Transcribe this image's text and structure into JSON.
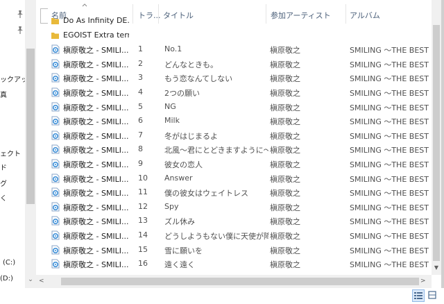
{
  "navigation": {
    "items": [
      {
        "label": "ックアップ"
      },
      {
        "label": "真"
      },
      {
        "label": "ェクト"
      },
      {
        "label": "ド"
      },
      {
        "label": "グ"
      },
      {
        "label": "く"
      },
      {
        "label": "(C:)"
      },
      {
        "label": "(D:)"
      }
    ]
  },
  "columns": {
    "name": "名前",
    "track": "トラ...",
    "title": "タイトル",
    "artist": "参加アーティスト",
    "album": "アルバム"
  },
  "folders": [
    {
      "name": "Do As Infinity DE..."
    },
    {
      "name": "EGOIST Extra terr..."
    }
  ],
  "files": [
    {
      "name": "槇原敬之 - SMILI...",
      "track": "1",
      "title": "No.1",
      "artist": "槇原敬之",
      "album": "SMILING ～THE BEST ..."
    },
    {
      "name": "槇原敬之 - SMILI...",
      "track": "2",
      "title": "どんなときも。",
      "artist": "槇原敬之",
      "album": "SMILING ～THE BEST ..."
    },
    {
      "name": "槇原敬之 - SMILI...",
      "track": "3",
      "title": "もう恋なんてしない",
      "artist": "槇原敬之",
      "album": "SMILING ～THE BEST ..."
    },
    {
      "name": "槇原敬之 - SMILI...",
      "track": "4",
      "title": "2つの願い",
      "artist": "槇原敬之",
      "album": "SMILING ～THE BEST ..."
    },
    {
      "name": "槇原敬之 - SMILI...",
      "track": "5",
      "title": "NG",
      "artist": "槇原敬之",
      "album": "SMILING ～THE BEST ..."
    },
    {
      "name": "槇原敬之 - SMILI...",
      "track": "6",
      "title": "Milk",
      "artist": "槇原敬之",
      "album": "SMILING ～THE BEST ..."
    },
    {
      "name": "槇原敬之 - SMILI...",
      "track": "7",
      "title": "冬がはじまるよ",
      "artist": "槇原敬之",
      "album": "SMILING ～THE BEST ..."
    },
    {
      "name": "槇原敬之 - SMILI...",
      "track": "8",
      "title": "北風～君にとどきますように～",
      "artist": "槇原敬之",
      "album": "SMILING ～THE BEST ..."
    },
    {
      "name": "槇原敬之 - SMILI...",
      "track": "9",
      "title": "彼女の恋人",
      "artist": "槇原敬之",
      "album": "SMILING ～THE BEST ..."
    },
    {
      "name": "槇原敬之 - SMILI...",
      "track": "10",
      "title": "Answer",
      "artist": "槇原敬之",
      "album": "SMILING ～THE BEST ..."
    },
    {
      "name": "槇原敬之 - SMILI...",
      "track": "11",
      "title": "僕の彼女はウェイトレス",
      "artist": "槇原敬之",
      "album": "SMILING ～THE BEST ..."
    },
    {
      "name": "槇原敬之 - SMILI...",
      "track": "12",
      "title": "Spy",
      "artist": "槇原敬之",
      "album": "SMILING ～THE BEST ..."
    },
    {
      "name": "槇原敬之 - SMILI...",
      "track": "13",
      "title": "ズル休み",
      "artist": "槇原敬之",
      "album": "SMILING ～THE BEST ..."
    },
    {
      "name": "槇原敬之 - SMILI...",
      "track": "14",
      "title": "どうしようもない僕に天使が降...",
      "artist": "槇原敬之",
      "album": "SMILING ～THE BEST ..."
    },
    {
      "name": "槇原敬之 - SMILI...",
      "track": "15",
      "title": "雪に願いを",
      "artist": "槇原敬之",
      "album": "SMILING ～THE BEST ..."
    },
    {
      "name": "槇原敬之 - SMILI...",
      "track": "16",
      "title": "遠く遠く",
      "artist": "槇原敬之",
      "album": "SMILING ～THE BEST ..."
    }
  ],
  "icons": {
    "folder": "folder-icon",
    "audio_file": "audio-file-icon",
    "pin": "pin-icon",
    "view_details": "details-view-icon",
    "view_tiles": "large-icons-view-icon"
  },
  "colors": {
    "folder": "#e8b93a",
    "audio_icon": "#3c8fd8",
    "header_text": "#4c607a",
    "selected_view": "#dbe9f9"
  }
}
